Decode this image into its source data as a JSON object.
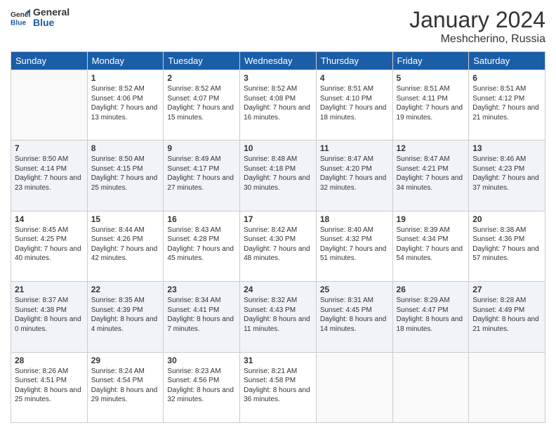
{
  "header": {
    "logo_line1": "General",
    "logo_line2": "Blue",
    "month_year": "January 2024",
    "location": "Meshcherino, Russia"
  },
  "days_of_week": [
    "Sunday",
    "Monday",
    "Tuesday",
    "Wednesday",
    "Thursday",
    "Friday",
    "Saturday"
  ],
  "weeks": [
    [
      {
        "day": "",
        "sunrise": "",
        "sunset": "",
        "daylight": ""
      },
      {
        "day": "1",
        "sunrise": "Sunrise: 8:52 AM",
        "sunset": "Sunset: 4:06 PM",
        "daylight": "Daylight: 7 hours and 13 minutes."
      },
      {
        "day": "2",
        "sunrise": "Sunrise: 8:52 AM",
        "sunset": "Sunset: 4:07 PM",
        "daylight": "Daylight: 7 hours and 15 minutes."
      },
      {
        "day": "3",
        "sunrise": "Sunrise: 8:52 AM",
        "sunset": "Sunset: 4:08 PM",
        "daylight": "Daylight: 7 hours and 16 minutes."
      },
      {
        "day": "4",
        "sunrise": "Sunrise: 8:51 AM",
        "sunset": "Sunset: 4:10 PM",
        "daylight": "Daylight: 7 hours and 18 minutes."
      },
      {
        "day": "5",
        "sunrise": "Sunrise: 8:51 AM",
        "sunset": "Sunset: 4:11 PM",
        "daylight": "Daylight: 7 hours and 19 minutes."
      },
      {
        "day": "6",
        "sunrise": "Sunrise: 8:51 AM",
        "sunset": "Sunset: 4:12 PM",
        "daylight": "Daylight: 7 hours and 21 minutes."
      }
    ],
    [
      {
        "day": "7",
        "sunrise": "Sunrise: 8:50 AM",
        "sunset": "Sunset: 4:14 PM",
        "daylight": "Daylight: 7 hours and 23 minutes."
      },
      {
        "day": "8",
        "sunrise": "Sunrise: 8:50 AM",
        "sunset": "Sunset: 4:15 PM",
        "daylight": "Daylight: 7 hours and 25 minutes."
      },
      {
        "day": "9",
        "sunrise": "Sunrise: 8:49 AM",
        "sunset": "Sunset: 4:17 PM",
        "daylight": "Daylight: 7 hours and 27 minutes."
      },
      {
        "day": "10",
        "sunrise": "Sunrise: 8:48 AM",
        "sunset": "Sunset: 4:18 PM",
        "daylight": "Daylight: 7 hours and 30 minutes."
      },
      {
        "day": "11",
        "sunrise": "Sunrise: 8:47 AM",
        "sunset": "Sunset: 4:20 PM",
        "daylight": "Daylight: 7 hours and 32 minutes."
      },
      {
        "day": "12",
        "sunrise": "Sunrise: 8:47 AM",
        "sunset": "Sunset: 4:21 PM",
        "daylight": "Daylight: 7 hours and 34 minutes."
      },
      {
        "day": "13",
        "sunrise": "Sunrise: 8:46 AM",
        "sunset": "Sunset: 4:23 PM",
        "daylight": "Daylight: 7 hours and 37 minutes."
      }
    ],
    [
      {
        "day": "14",
        "sunrise": "Sunrise: 8:45 AM",
        "sunset": "Sunset: 4:25 PM",
        "daylight": "Daylight: 7 hours and 40 minutes."
      },
      {
        "day": "15",
        "sunrise": "Sunrise: 8:44 AM",
        "sunset": "Sunset: 4:26 PM",
        "daylight": "Daylight: 7 hours and 42 minutes."
      },
      {
        "day": "16",
        "sunrise": "Sunrise: 8:43 AM",
        "sunset": "Sunset: 4:28 PM",
        "daylight": "Daylight: 7 hours and 45 minutes."
      },
      {
        "day": "17",
        "sunrise": "Sunrise: 8:42 AM",
        "sunset": "Sunset: 4:30 PM",
        "daylight": "Daylight: 7 hours and 48 minutes."
      },
      {
        "day": "18",
        "sunrise": "Sunrise: 8:40 AM",
        "sunset": "Sunset: 4:32 PM",
        "daylight": "Daylight: 7 hours and 51 minutes."
      },
      {
        "day": "19",
        "sunrise": "Sunrise: 8:39 AM",
        "sunset": "Sunset: 4:34 PM",
        "daylight": "Daylight: 7 hours and 54 minutes."
      },
      {
        "day": "20",
        "sunrise": "Sunrise: 8:38 AM",
        "sunset": "Sunset: 4:36 PM",
        "daylight": "Daylight: 7 hours and 57 minutes."
      }
    ],
    [
      {
        "day": "21",
        "sunrise": "Sunrise: 8:37 AM",
        "sunset": "Sunset: 4:38 PM",
        "daylight": "Daylight: 8 hours and 0 minutes."
      },
      {
        "day": "22",
        "sunrise": "Sunrise: 8:35 AM",
        "sunset": "Sunset: 4:39 PM",
        "daylight": "Daylight: 8 hours and 4 minutes."
      },
      {
        "day": "23",
        "sunrise": "Sunrise: 8:34 AM",
        "sunset": "Sunset: 4:41 PM",
        "daylight": "Daylight: 8 hours and 7 minutes."
      },
      {
        "day": "24",
        "sunrise": "Sunrise: 8:32 AM",
        "sunset": "Sunset: 4:43 PM",
        "daylight": "Daylight: 8 hours and 11 minutes."
      },
      {
        "day": "25",
        "sunrise": "Sunrise: 8:31 AM",
        "sunset": "Sunset: 4:45 PM",
        "daylight": "Daylight: 8 hours and 14 minutes."
      },
      {
        "day": "26",
        "sunrise": "Sunrise: 8:29 AM",
        "sunset": "Sunset: 4:47 PM",
        "daylight": "Daylight: 8 hours and 18 minutes."
      },
      {
        "day": "27",
        "sunrise": "Sunrise: 8:28 AM",
        "sunset": "Sunset: 4:49 PM",
        "daylight": "Daylight: 8 hours and 21 minutes."
      }
    ],
    [
      {
        "day": "28",
        "sunrise": "Sunrise: 8:26 AM",
        "sunset": "Sunset: 4:51 PM",
        "daylight": "Daylight: 8 hours and 25 minutes."
      },
      {
        "day": "29",
        "sunrise": "Sunrise: 8:24 AM",
        "sunset": "Sunset: 4:54 PM",
        "daylight": "Daylight: 8 hours and 29 minutes."
      },
      {
        "day": "30",
        "sunrise": "Sunrise: 8:23 AM",
        "sunset": "Sunset: 4:56 PM",
        "daylight": "Daylight: 8 hours and 32 minutes."
      },
      {
        "day": "31",
        "sunrise": "Sunrise: 8:21 AM",
        "sunset": "Sunset: 4:58 PM",
        "daylight": "Daylight: 8 hours and 36 minutes."
      },
      {
        "day": "",
        "sunrise": "",
        "sunset": "",
        "daylight": ""
      },
      {
        "day": "",
        "sunrise": "",
        "sunset": "",
        "daylight": ""
      },
      {
        "day": "",
        "sunrise": "",
        "sunset": "",
        "daylight": ""
      }
    ]
  ]
}
